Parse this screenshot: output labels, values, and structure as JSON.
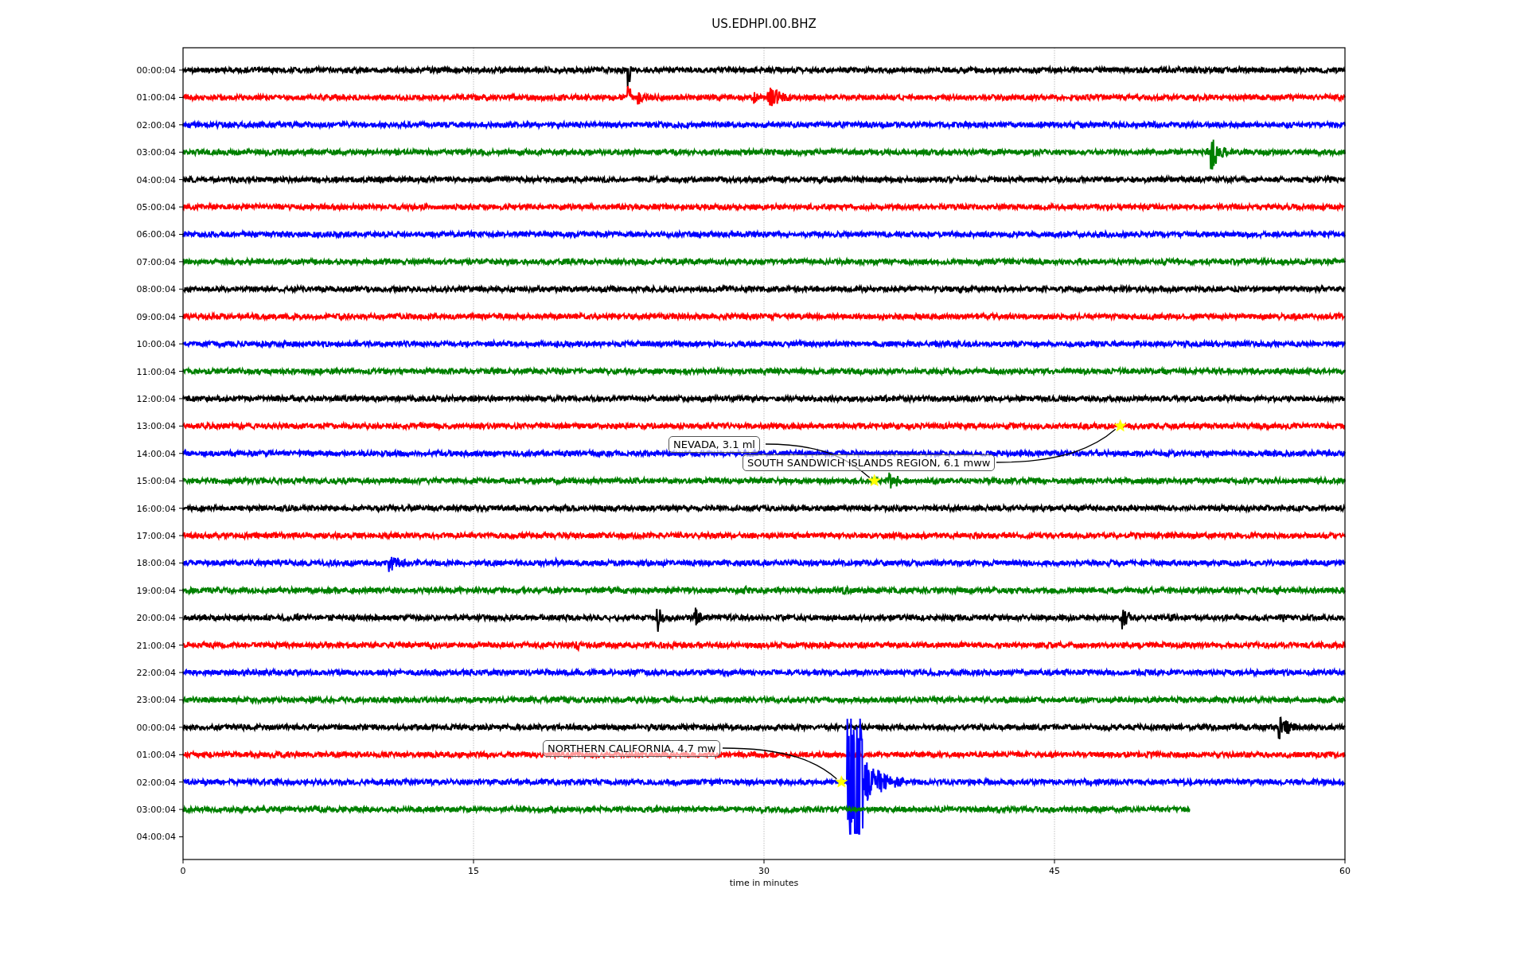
{
  "title": "US.EDHPI.00.BHZ",
  "y_tick_labels": [
    "00:00:04",
    "01:00:04",
    "02:00:04",
    "03:00:04",
    "04:00:04",
    "05:00:04",
    "06:00:04",
    "07:00:04",
    "08:00:04",
    "09:00:04",
    "10:00:04",
    "11:00:04",
    "12:00:04",
    "13:00:04",
    "14:00:04",
    "15:00:04",
    "16:00:04",
    "17:00:04",
    "18:00:04",
    "19:00:04",
    "20:00:04",
    "21:00:04",
    "22:00:04",
    "23:00:04",
    "00:00:04",
    "01:00:04",
    "02:00:04",
    "03:00:04",
    "04:00:04"
  ],
  "x_ticks": [
    "0",
    "15",
    "30",
    "45",
    "60"
  ],
  "xlabel": "time in minutes",
  "traces": [
    {
      "color": "#000000"
    },
    {
      "color": "#ff0000"
    },
    {
      "color": "#0000ff"
    },
    {
      "color": "#008000"
    },
    {
      "color": "#000000"
    },
    {
      "color": "#ff0000"
    },
    {
      "color": "#0000ff"
    },
    {
      "color": "#008000"
    },
    {
      "color": "#000000"
    },
    {
      "color": "#ff0000"
    },
    {
      "color": "#0000ff"
    },
    {
      "color": "#008000"
    },
    {
      "color": "#000000"
    },
    {
      "color": "#ff0000"
    },
    {
      "color": "#0000ff"
    },
    {
      "color": "#008000"
    },
    {
      "color": "#000000"
    },
    {
      "color": "#ff0000"
    },
    {
      "color": "#0000ff"
    },
    {
      "color": "#008000"
    },
    {
      "color": "#000000"
    },
    {
      "color": "#ff0000"
    },
    {
      "color": "#0000ff"
    },
    {
      "color": "#008000"
    },
    {
      "color": "#000000"
    },
    {
      "color": "#ff0000"
    },
    {
      "color": "#0000ff"
    },
    {
      "color": "#008000"
    }
  ],
  "events": [
    {
      "label": "NEVADA, 3.1 ml"
    },
    {
      "label": "SOUTH SANDWICH ISLANDS REGION, 6.1 mww"
    },
    {
      "label": "NORTHERN CALIFORNIA, 4.7 mw"
    }
  ]
}
